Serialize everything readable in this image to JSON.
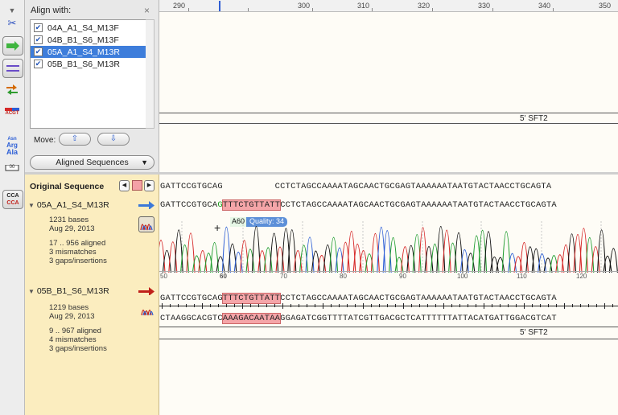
{
  "align_panel": {
    "title": "Align with:",
    "close": "×",
    "sequences": [
      {
        "label": "04A_A1_S4_M13F",
        "checked": true,
        "selected": false
      },
      {
        "label": "04B_B1_S6_M13F",
        "checked": true,
        "selected": false
      },
      {
        "label": "05A_A1_S4_M13R",
        "checked": true,
        "selected": true
      },
      {
        "label": "05B_B1_S6_M13R",
        "checked": true,
        "selected": false
      }
    ],
    "move_label": "Move:",
    "move_up": "⇧",
    "move_down": "⇩",
    "view_dropdown": "Aligned Sequences"
  },
  "toolbar": {
    "acgt": "ACGT",
    "asn": "Asn",
    "arg": "Arg",
    "ala": "Ala",
    "cca1": "CCA",
    "cca2": "CCA",
    "num_00": "00"
  },
  "ruler": {
    "ticks": [
      "290",
      "300",
      "310",
      "320",
      "330",
      "340",
      "350"
    ]
  },
  "upper_feature": "5' SFT2",
  "original": {
    "title": "Original Sequence",
    "sequence": "GATTCCGTGCAG          CCTCTAGCCAAAATAGCAACTGCGAGTAAAAAATAATGTACTAACCTGCAGTA"
  },
  "reads": [
    {
      "name": "05A_A1_S4_M13R",
      "bases": "1231 bases",
      "date": "Aug 29, 2013",
      "aligned": "17 .. 956 aligned",
      "mismatches": "3 mismatches",
      "gaps": "3 gaps/insertions",
      "seq_pre": "GATTCCGTGCA",
      "seq_green": "G",
      "seq_hl": "TTTCTGTTATT",
      "seq_post": "CCTCTAGCCAAAATAGCAACTGCGAGTAAAAAATAATGTACTAACCTGCAGTA",
      "direction_color": "#3b78d8"
    },
    {
      "name": "05B_B1_S6_M13R",
      "bases": "1219 bases",
      "date": "Aug 29, 2013",
      "aligned": "9 .. 967 aligned",
      "mismatches": "4 mismatches",
      "gaps": "3 gaps/insertions",
      "direction_color": "#c0201a"
    }
  ],
  "quality_tag": {
    "base": "A60",
    "quality": "Quality: 34"
  },
  "chrom_axis": [
    "50",
    "60",
    "70",
    "80",
    "90",
    "100",
    "110",
    "120"
  ],
  "consensus": {
    "top_pre": "GATTCCGTGCAG",
    "top_hl": "TTTCTGTTATT",
    "top_post": "CCTCTAGCCAAAATAGCAACTGCGAGTAAAAAATAATGTACTAACCTGCAGTA",
    "bottom_pre": "CTAAGGCACGTC",
    "bottom_hl": "AAAGACAATAA",
    "bottom_post": "GGAGATCGGTTTTATCGTTGACGCTCATTTTTTATTACATGATTGGACGTCAT",
    "feature": "5' SFT2"
  },
  "colors": {
    "A": "#1f9d2f",
    "C": "#2c5ed6",
    "G": "#111111",
    "T": "#d62828"
  }
}
